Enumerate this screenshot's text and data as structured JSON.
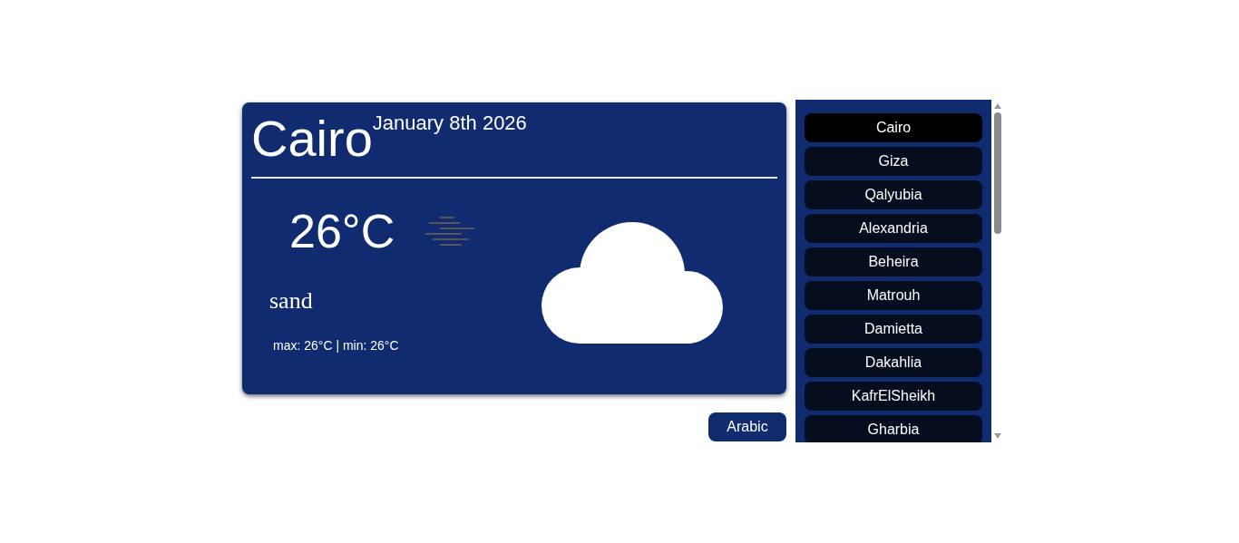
{
  "card": {
    "city": "Cairo",
    "date": "January 8th 2026",
    "temperature": "26°C",
    "condition": {
      "kind": "haze"
    },
    "description": "sand",
    "range": "max: 26°C | min: 26°C",
    "sky": {
      "kind": "cloud"
    }
  },
  "language_button": "Arabic",
  "cities": [
    {
      "name": "Cairo",
      "selected": true
    },
    {
      "name": "Giza",
      "selected": false
    },
    {
      "name": "Qalyubia",
      "selected": false
    },
    {
      "name": "Alexandria",
      "selected": false
    },
    {
      "name": "Beheira",
      "selected": false
    },
    {
      "name": "Matrouh",
      "selected": false
    },
    {
      "name": "Damietta",
      "selected": false
    },
    {
      "name": "Dakahlia",
      "selected": false
    },
    {
      "name": "KafrElSheikh",
      "selected": false
    },
    {
      "name": "Gharbia",
      "selected": false
    }
  ]
}
